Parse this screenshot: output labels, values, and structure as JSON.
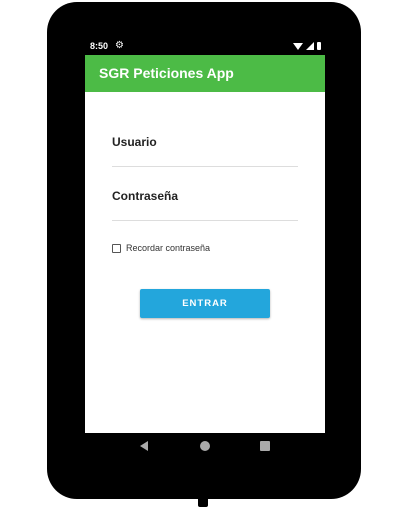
{
  "status_bar": {
    "time": "8:50",
    "settings_icon": "gear-icon",
    "wifi_icon": "wifi-icon",
    "signal_icon": "signal-icon",
    "battery_icon": "battery-icon"
  },
  "app_bar": {
    "title": "SGR Peticiones App",
    "color": "#4cbb46"
  },
  "login": {
    "username_placeholder": "Usuario",
    "username_value": "",
    "password_placeholder": "Contraseña",
    "password_value": "",
    "remember_label": "Recordar contraseña",
    "remember_checked": false,
    "submit_label": "ENTRAR",
    "button_color": "#23a6dc"
  },
  "nav_bar": {
    "back_icon": "back-triangle-icon",
    "home_icon": "home-circle-icon",
    "recent_icon": "recent-square-icon"
  }
}
